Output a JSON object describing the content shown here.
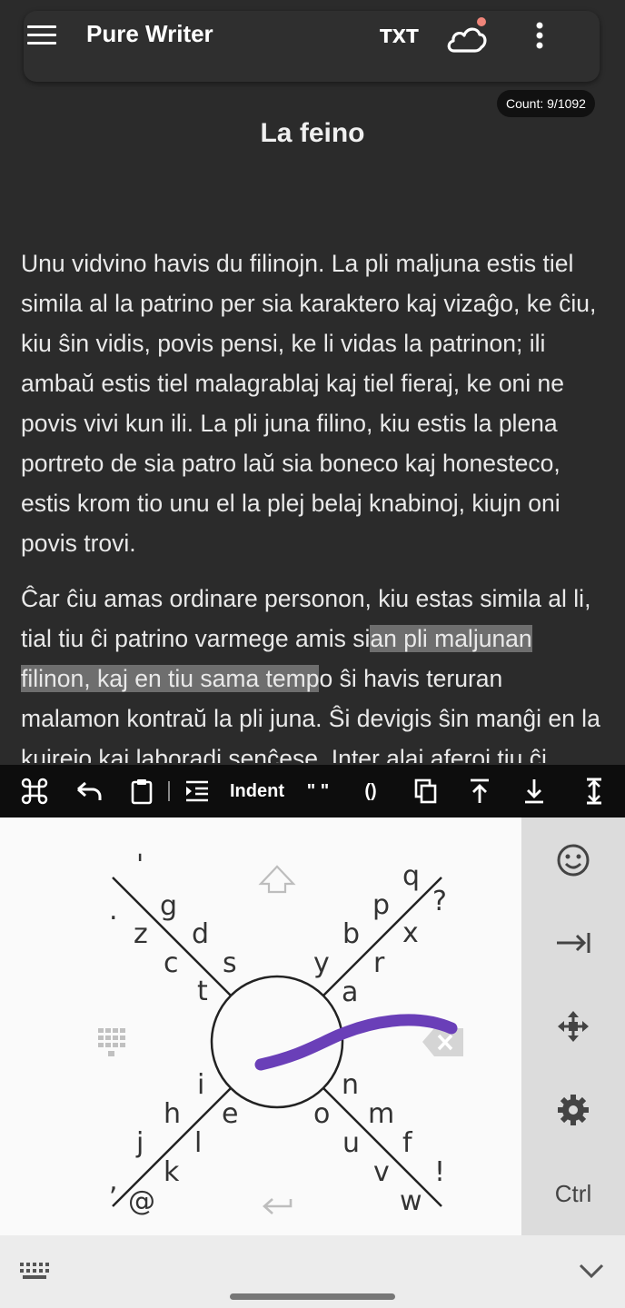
{
  "app": {
    "title": "Pure Writer",
    "txt_label": "TXT",
    "count": "Count: 9/1092"
  },
  "document": {
    "title": "La feino",
    "paragraph1": "Unu vidvino havis du filinojn. La pli maljuna estis tiel simila al la patrino per sia karaktero kaj vizaĝo, ke ĉiu, kiu ŝin vidis, povis pensi, ke li vidas la patrinon; ili ambaŭ estis tiel malagrablaj kaj tiel fieraj, ke oni ne povis vivi kun ili. La pli juna filino, kiu estis la plena portreto de sia patro laŭ sia boneco kaj honesteco, estis krom tio unu el la plej belaj knabinoj, kiujn oni povis trovi.",
    "paragraph2_before": "Ĉar ĉiu amas ordinare personon, kiu estas simila al li, tial tiu ĉi patrino varmege amis si",
    "paragraph2_selected": "an pli maljunan filinon, kaj en tiu sama temp",
    "paragraph2_after": "o ŝi havis teruran malamon kontraŭ la pli juna. Ŝi devigis ŝin manĝi en la kuirejo kaj laboradi senĉese. Inter alaj aferoj tiu ĉi malfeliĉa infano devis du fojojn"
  },
  "toolbar": {
    "items": [
      "command-icon",
      "undo-icon",
      "paste-icon",
      "indent-icon",
      "Indent",
      "\" \"",
      "()",
      "copy-icon",
      "move-top-icon",
      "move-bottom-icon",
      "text-cursor-icon"
    ],
    "indent_label": "Indent",
    "quotes_label": "\" \"",
    "parens_label": "()"
  },
  "keyboard": {
    "top_left_outer": [
      "'",
      ".",
      "g",
      "z",
      "d",
      "c",
      "s",
      "t"
    ],
    "top_right_outer": [
      "q",
      "?",
      "p",
      "x",
      "b",
      "r",
      "y",
      "a"
    ],
    "bottom_left_outer": [
      "i",
      "h",
      "e",
      "j",
      "l",
      "k",
      ",",
      "@"
    ],
    "bottom_right_outer": [
      "n",
      "o",
      "m",
      "u",
      "f",
      "v",
      "!",
      "w"
    ],
    "ctrl_label": "Ctrl",
    "side_icons": [
      "emoji-icon",
      "tab-icon",
      "move-cursor-icon",
      "settings-icon"
    ],
    "swipe_color": "#6a3fb8"
  },
  "colors": {
    "background": "#2b2b2b",
    "selection": "#6e6e6e",
    "toolbar": "#0d0d0d",
    "keyboard": "#fafafa",
    "keyboard_side": "#dcdcdc"
  }
}
